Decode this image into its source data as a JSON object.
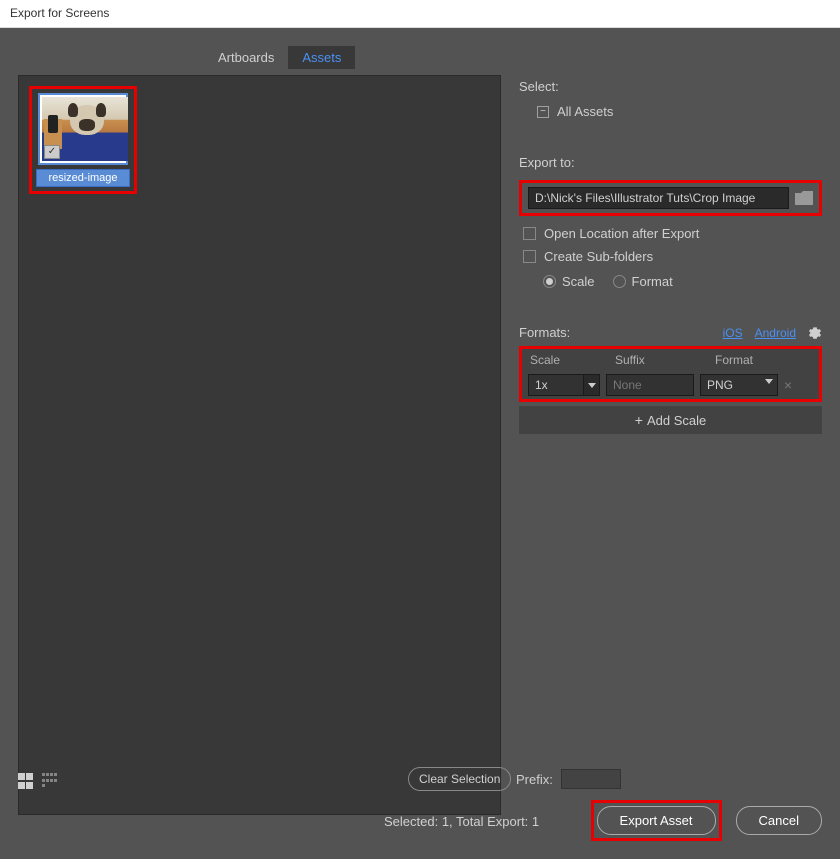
{
  "window": {
    "title": "Export for Screens"
  },
  "tabs": {
    "artboards": "Artboards",
    "assets": "Assets"
  },
  "thumbnail": {
    "label": "resized-image",
    "checked": true
  },
  "select": {
    "label": "Select:",
    "all_assets": "All Assets"
  },
  "export_to": {
    "label": "Export to:",
    "path": "D:\\Nick's Files\\Illustrator Tuts\\Crop Image",
    "open_location": "Open Location after Export",
    "create_subfolders": "Create Sub-folders",
    "scale_radio": "Scale",
    "format_radio": "Format"
  },
  "formats": {
    "label": "Formats:",
    "ios": "iOS",
    "android": "Android",
    "col_scale": "Scale",
    "col_suffix": "Suffix",
    "col_format": "Format",
    "row": {
      "scale": "1x",
      "suffix": "None",
      "format": "PNG"
    },
    "add_scale": "Add Scale"
  },
  "bottom": {
    "clear_selection": "Clear Selection",
    "prefix_label": "Prefix:",
    "status": "Selected: 1, Total Export: 1",
    "export_btn": "Export Asset",
    "cancel_btn": "Cancel"
  }
}
